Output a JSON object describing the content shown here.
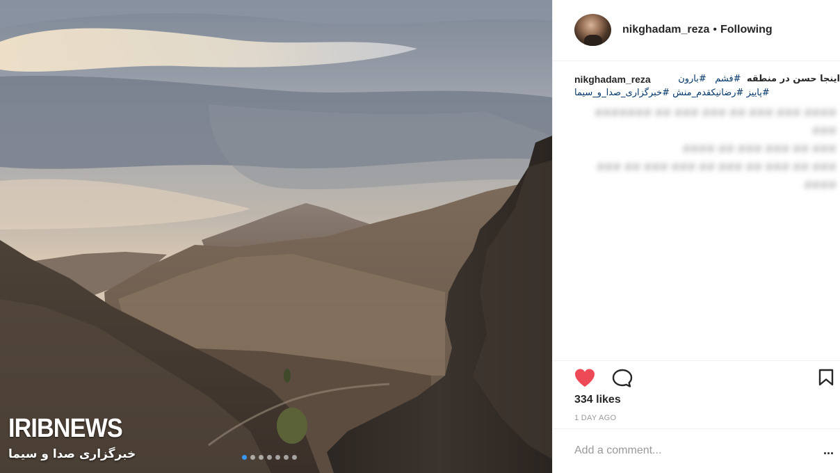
{
  "post": {
    "watermark": {
      "brand": "IRIBNEWS",
      "subtitle": "خبرگزاری صدا و سیما"
    },
    "carousel": {
      "count": 7,
      "active_index": 0
    }
  },
  "header": {
    "username": "nikghadam_reza",
    "separator": "•",
    "follow_status": "Following"
  },
  "caption": {
    "username": "nikghadam_reza",
    "line1_text": "اینجا حسن در منطقه",
    "line1_tags": [
      "#فشم",
      "#بارون"
    ],
    "line2_tags": [
      "#پاییز",
      "#رضانیکقدم_منش",
      "#خبرگزاری_صدا_و_سیما"
    ],
    "blurred_lines": [
      "#### ### ### ## ### ### ## ####### ###",
      "### ## ### ### ## ####",
      "### ## ### ## ### ## ### ### ## ### ####"
    ]
  },
  "engagement": {
    "likes_label": "334 likes",
    "time_ago": "1 DAY AGO",
    "liked": true,
    "like_color": "#ed4956"
  },
  "comment": {
    "placeholder": "Add a comment...",
    "more_label": "..."
  },
  "icons": {
    "like": "heart-icon",
    "comment": "comment-icon",
    "save": "bookmark-icon",
    "more": "more-options-icon"
  }
}
